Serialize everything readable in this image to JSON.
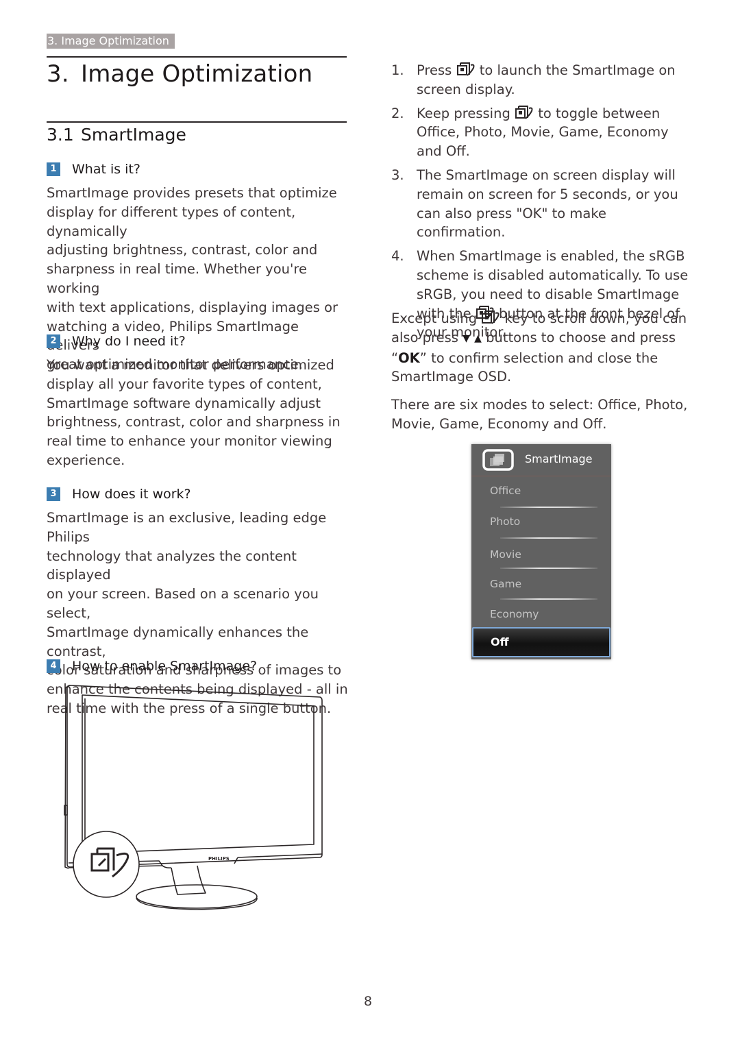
{
  "header": {
    "breadcrumb": "3. Image Optimization"
  },
  "chapter": {
    "number": "3.",
    "title": "Image Optimization"
  },
  "section": {
    "number": "3.1",
    "title": "SmartImage"
  },
  "subsections": [
    {
      "badge": "1",
      "heading": "What is it?",
      "lines": [
        "SmartImage provides presets that optimize",
        "display for different types of content, dynamically",
        "adjusting brightness, contrast, color and",
        "sharpness in real time. Whether you're working",
        "with text applications, displaying images or",
        "watching a video, Philips SmartImage delivers",
        "great optimized monitor performance."
      ]
    },
    {
      "badge": "2",
      "heading": "Why do I need it?",
      "lines": [
        "You want a monitor that delivers optimized",
        "display all your favorite types of content,",
        "SmartImage software dynamically adjust",
        "brightness, contrast, color and sharpness in",
        "real time to enhance your monitor viewing",
        "experience."
      ]
    },
    {
      "badge": "3",
      "heading": "How does it work?",
      "lines": [
        "SmartImage is an exclusive, leading edge Philips",
        "technology that analyzes the content displayed",
        "on your screen. Based on a scenario you select,",
        "SmartImage dynamically enhances the contrast,",
        "color saturation and sharpness of images to",
        "enhance the contents being displayed - all in",
        "real time with the press of a single button."
      ]
    },
    {
      "badge": "4",
      "heading": "How to enable SmartImage?"
    }
  ],
  "steps": [
    {
      "n": "1.",
      "before": "Press",
      "icon": "smartimage-key-icon",
      "after": "to launch the SmartImage on screen display."
    },
    {
      "n": "2.",
      "before": "Keep pressing",
      "icon": "smartimage-key-icon",
      "after": "to toggle between Office, Photo, Movie, Game, Economy and Off."
    },
    {
      "n": "3.",
      "text": "The SmartImage on screen display will remain on screen for 5 seconds, or you can also press \"OK\" to make confirmation."
    },
    {
      "n": "4.",
      "before": "When SmartImage is enabled, the sRGB scheme is disabled automatically. To use sRGB, you need to disable SmartImage with the",
      "icon": "smartimage-key-icon",
      "after": "button at the front bezel of your monitor."
    }
  ],
  "except_para": {
    "part1": "Except using",
    "part2": "key to scroll down, you can also press",
    "down_arrow": "▼",
    "up_arrow": "▲",
    "part3": "buttons to choose and press “",
    "ok": "OK",
    "part4": "” to confirm selection and close the SmartImage OSD."
  },
  "modes_para": "There are six modes to select: Office, Photo, Movie, Game, Economy and Off.",
  "osd": {
    "title": "SmartImage",
    "items": [
      "Office",
      "Photo",
      "Movie",
      "Game",
      "Economy"
    ],
    "selected": "Off",
    "colors": {
      "panel": "#616161",
      "selected_border": "#7fa9d8",
      "badge_blue": "#3c7db1"
    }
  },
  "illustration": {
    "brand": "PHILIPS",
    "icon": "smartimage-key-icon"
  },
  "footer": {
    "page_number": "8"
  }
}
